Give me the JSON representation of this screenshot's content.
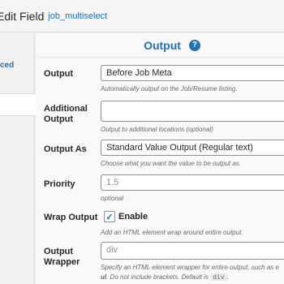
{
  "header": {
    "title": "Edit Field",
    "field_name": "job_multiselect"
  },
  "sidebar": {
    "partial_item": "ced"
  },
  "section": {
    "title": "Output",
    "help_symbol": "?"
  },
  "fields": {
    "output": {
      "label": "Output",
      "value": "Before Job Meta",
      "description": "Automatically output on the Job/Resume listing."
    },
    "additional_output": {
      "label_line1": "Additional",
      "label_line2": "Output",
      "value": "",
      "description": "Output to additional locations (optional)"
    },
    "output_as": {
      "label": "Output As",
      "value": "Standard Value Output (Regular text)",
      "description": "Choose what you want the value to be output as."
    },
    "priority": {
      "label": "Priority",
      "placeholder": "1.5",
      "description": "optional"
    },
    "wrap_output": {
      "label": "Wrap Output",
      "checkbox_label": "Enable",
      "checked": true,
      "description": "Add an HTML element wrap around entire output."
    },
    "output_wrapper": {
      "label_line1": "Output",
      "label_line2": "Wrapper",
      "placeholder": "div",
      "description_line1": "Specify an HTML element wrapper for entire output, such as e",
      "description_bold": "ul",
      "description_line2_rest": ". Do not include brackets. Default is",
      "description_code": "div",
      "description_end": "."
    }
  },
  "colors": {
    "accent": "#2271b1",
    "text": "#23282d",
    "muted": "#646970"
  }
}
